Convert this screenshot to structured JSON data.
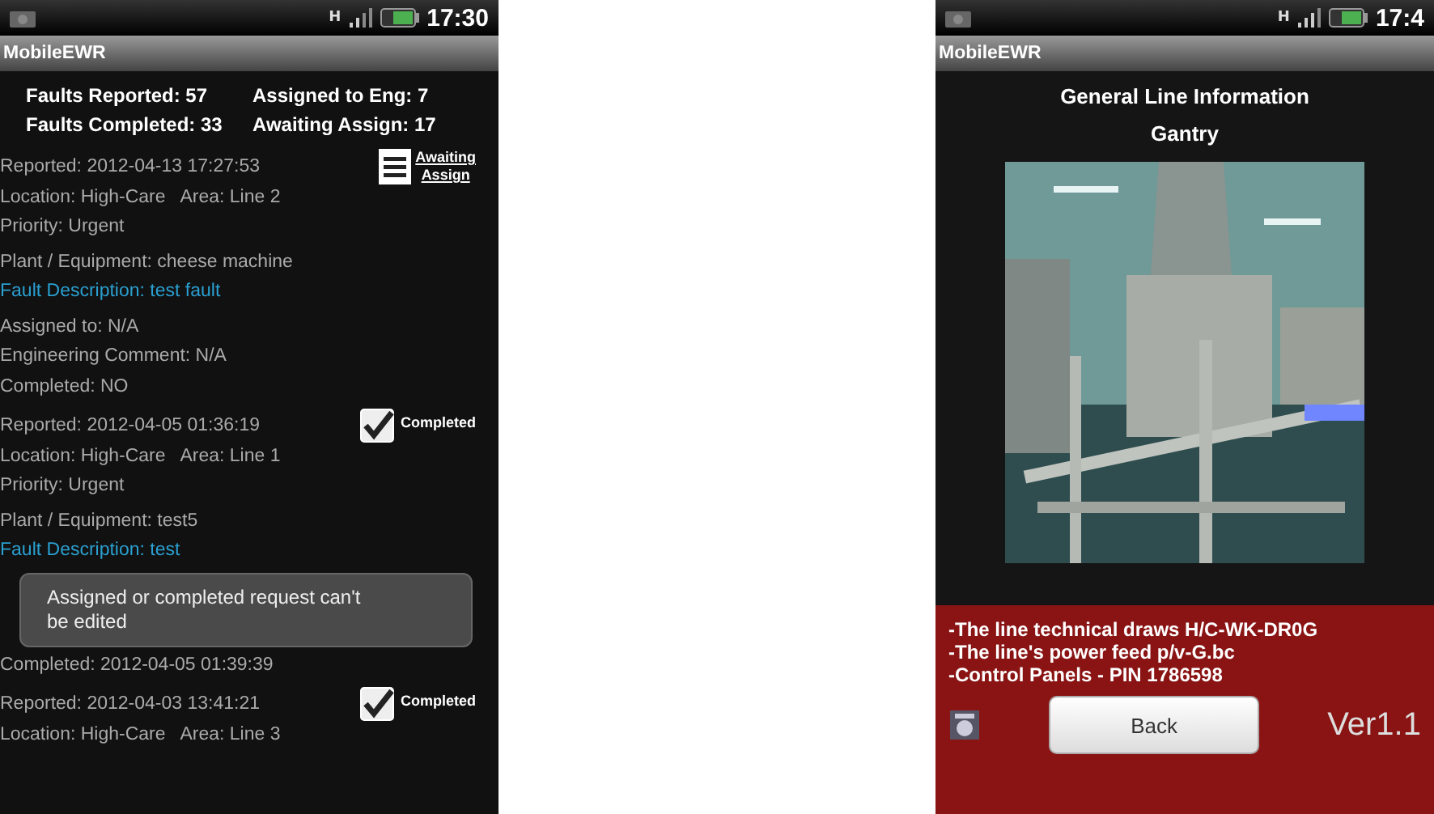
{
  "left_phone": {
    "status_bar": {
      "time": "17:30",
      "network": "H"
    },
    "app_title": "MobileEWR",
    "stats": [
      {
        "label": "Faults Reported: 57"
      },
      {
        "label": "Assigned to Eng: 7"
      },
      {
        "label": "Faults Completed: 33"
      },
      {
        "label": "Awaiting Assign: 17"
      }
    ],
    "records": [
      {
        "status": {
          "kind": "awaiting",
          "label_lines": [
            "Awaiting",
            "Assign"
          ]
        },
        "sections": [
          [
            {
              "kind": "text",
              "text": "Reported: 2012-04-13 17:27:53"
            },
            {
              "kind": "text",
              "text": "Location: High-Care   Area: Line 2"
            },
            {
              "kind": "text",
              "text": "Priority: Urgent"
            }
          ],
          [
            {
              "kind": "text",
              "text": "Plant / Equipment: cheese machine"
            },
            {
              "kind": "link",
              "text": "Fault Description: test fault"
            }
          ],
          [
            {
              "kind": "text",
              "text": "Assigned to: N/A"
            },
            {
              "kind": "text",
              "text": "Engineering Comment: N/A"
            },
            {
              "kind": "text",
              "text": "Completed: NO"
            }
          ]
        ]
      },
      {
        "status": {
          "kind": "completed",
          "label_lines": [
            "Completed"
          ]
        },
        "sections": [
          [
            {
              "kind": "text",
              "text": "Reported: 2012-04-05 01:36:19"
            },
            {
              "kind": "text",
              "text": "Location: High-Care   Area: Line 1"
            },
            {
              "kind": "text",
              "text": "Priority: Urgent"
            }
          ],
          [
            {
              "kind": "text",
              "text": "Plant / Equipment: test5"
            },
            {
              "kind": "link",
              "text": "Fault Description: test"
            }
          ],
          [
            {
              "kind": "toast",
              "text": "Assigned or completed request can't be edited"
            },
            {
              "kind": "text",
              "text": "Completed: 2012-04-05 01:39:39"
            }
          ]
        ]
      },
      {
        "status": {
          "kind": "completed",
          "label_lines": [
            "Completed"
          ]
        },
        "sections": [
          [
            {
              "kind": "text",
              "text": "Reported: 2012-04-03 13:41:21"
            },
            {
              "kind": "text",
              "text": "Location: High-Care   Area: Line 3"
            }
          ]
        ]
      }
    ]
  },
  "right_phone": {
    "status_bar": {
      "time": "17:4",
      "network": "H"
    },
    "app_title": "MobileEWR",
    "heading": "General Line Information",
    "subheading": "Gantry",
    "photo": {
      "kind": "picture"
    },
    "info_lines": [
      "-The line technical draws H/C-WK-DR0G",
      "-The line's power feed p/v-G.bc",
      "-Control Panels - PIN 1786598"
    ],
    "back_button": "Back",
    "version": "Ver1.1"
  }
}
